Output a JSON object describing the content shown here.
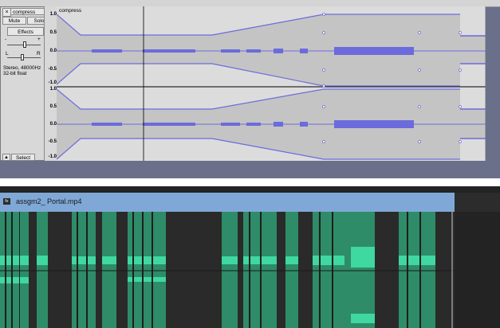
{
  "audacity": {
    "track": {
      "close_glyph": "×",
      "name": "compress",
      "dropdown_glyph": "▼",
      "mute_label": "Mute",
      "solo_label": "Solo",
      "effects_label": "Effects",
      "gain_minus": "-",
      "gain_plus": "+",
      "pan_left": "L",
      "pan_right": "R",
      "info_line1": "Stereo, 48000Hz",
      "info_line2": "32-bit float",
      "select_label": "Select",
      "collapse_glyph": "▲",
      "clip_title": "compress"
    },
    "vertical_ruler": {
      "ch1": [
        "1.0",
        "0.5",
        "0.0",
        "-0.5",
        "-1.0"
      ],
      "ch2": [
        "1.0",
        "0.5",
        "0.0",
        "-0.5",
        "-1.0"
      ]
    },
    "colors": {
      "waveform": "#6b6bdc",
      "envelope_area": "#c4c4c4",
      "background": "#dcdcdc",
      "bottom_strip": "#6a6f8a"
    }
  },
  "premiere": {
    "clip_badge": "fx",
    "clip_name": "assgm2_ Portal.mp4",
    "colors": {
      "clip_header": "#7fa8d6",
      "waveform": "#3fd8a0",
      "background": "#232323"
    }
  }
}
